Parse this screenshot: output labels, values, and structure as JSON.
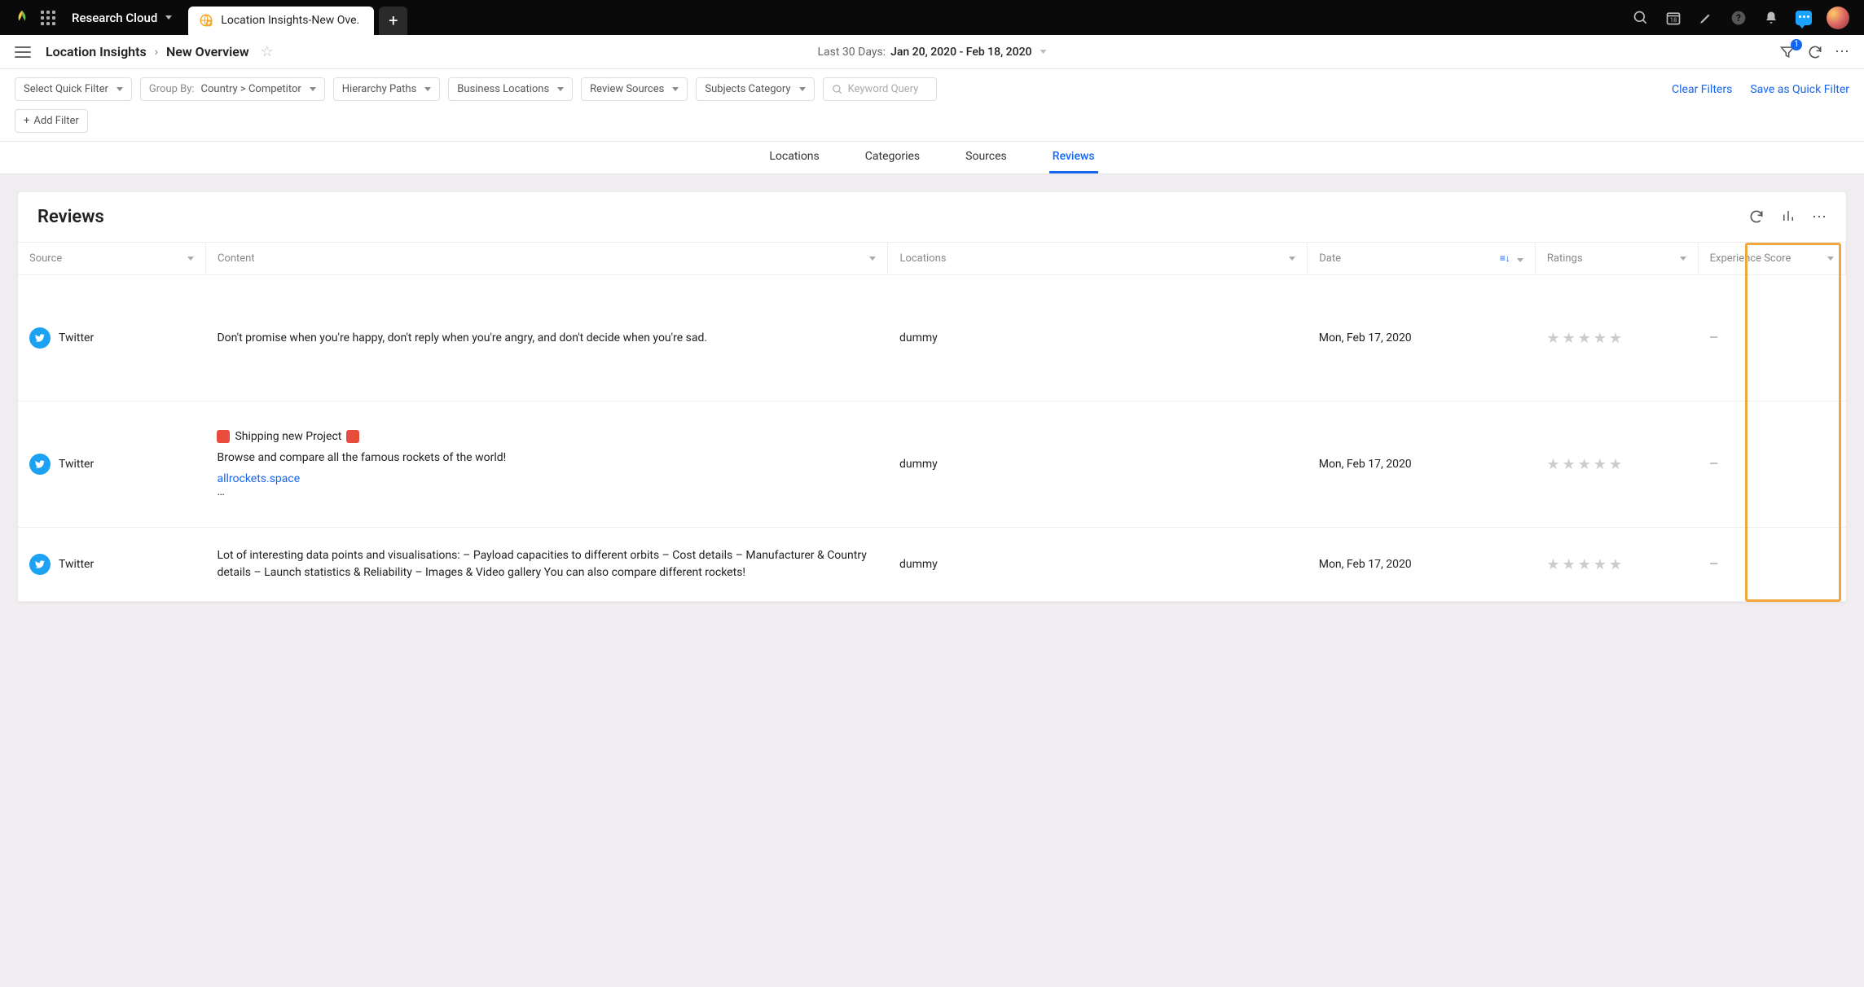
{
  "topbar": {
    "workspace": "Research Cloud",
    "active_tab": "Location Insights-New Ove…",
    "icons": {
      "search": "search-icon",
      "calendar": "calendar-icon",
      "calendar_day": "18",
      "edit": "pencil-icon",
      "help": "help-icon",
      "bell": "bell-icon",
      "chat": "chat-icon"
    }
  },
  "breadcrumb": {
    "part1": "Location Insights",
    "part2": "New Overview"
  },
  "date_range": {
    "label": "Last 30 Days:",
    "value": "Jan 20, 2020 - Feb 18, 2020"
  },
  "subbar_badge": "1",
  "filters": {
    "quick_filter": "Select Quick Filter",
    "group_by_label": "Group By:",
    "group_by_value": "Country > Competitor",
    "hierarchy": "Hierarchy Paths",
    "locations": "Business Locations",
    "sources": "Review Sources",
    "subjects": "Subjects Category",
    "keyword_placeholder": "Keyword Query",
    "add_filter": "Add Filter",
    "clear": "Clear Filters",
    "save": "Save as Quick Filter"
  },
  "tabs": {
    "t1": "Locations",
    "t2": "Categories",
    "t3": "Sources",
    "t4": "Reviews"
  },
  "card": {
    "title": "Reviews"
  },
  "columns": {
    "source": "Source",
    "content": "Content",
    "locations": "Locations",
    "date": "Date",
    "ratings": "Ratings",
    "experience": "Experience Score"
  },
  "rows": [
    {
      "source": "Twitter",
      "content_main": "Don't promise when you're happy, don't reply when you're angry, and don't decide when you're sad.",
      "location": "dummy",
      "date": "Mon, Feb 17, 2020",
      "exp": "—"
    },
    {
      "source": "Twitter",
      "content_title": "Shipping new Project",
      "content_main": "Browse and compare all the famous rockets of the world!",
      "content_link": "allrockets.space",
      "content_trail": "…",
      "location": "dummy",
      "date": "Mon, Feb 17, 2020",
      "exp": "—"
    },
    {
      "source": "Twitter",
      "content_main": "Lot of interesting data points and visualisations: – Payload capacities to different orbits – Cost details – Manufacturer & Country details – Launch statistics & Reliability – Images & Video gallery You can also compare different rockets!",
      "location": "dummy",
      "date": "Mon, Feb 17, 2020",
      "exp": "—"
    }
  ]
}
